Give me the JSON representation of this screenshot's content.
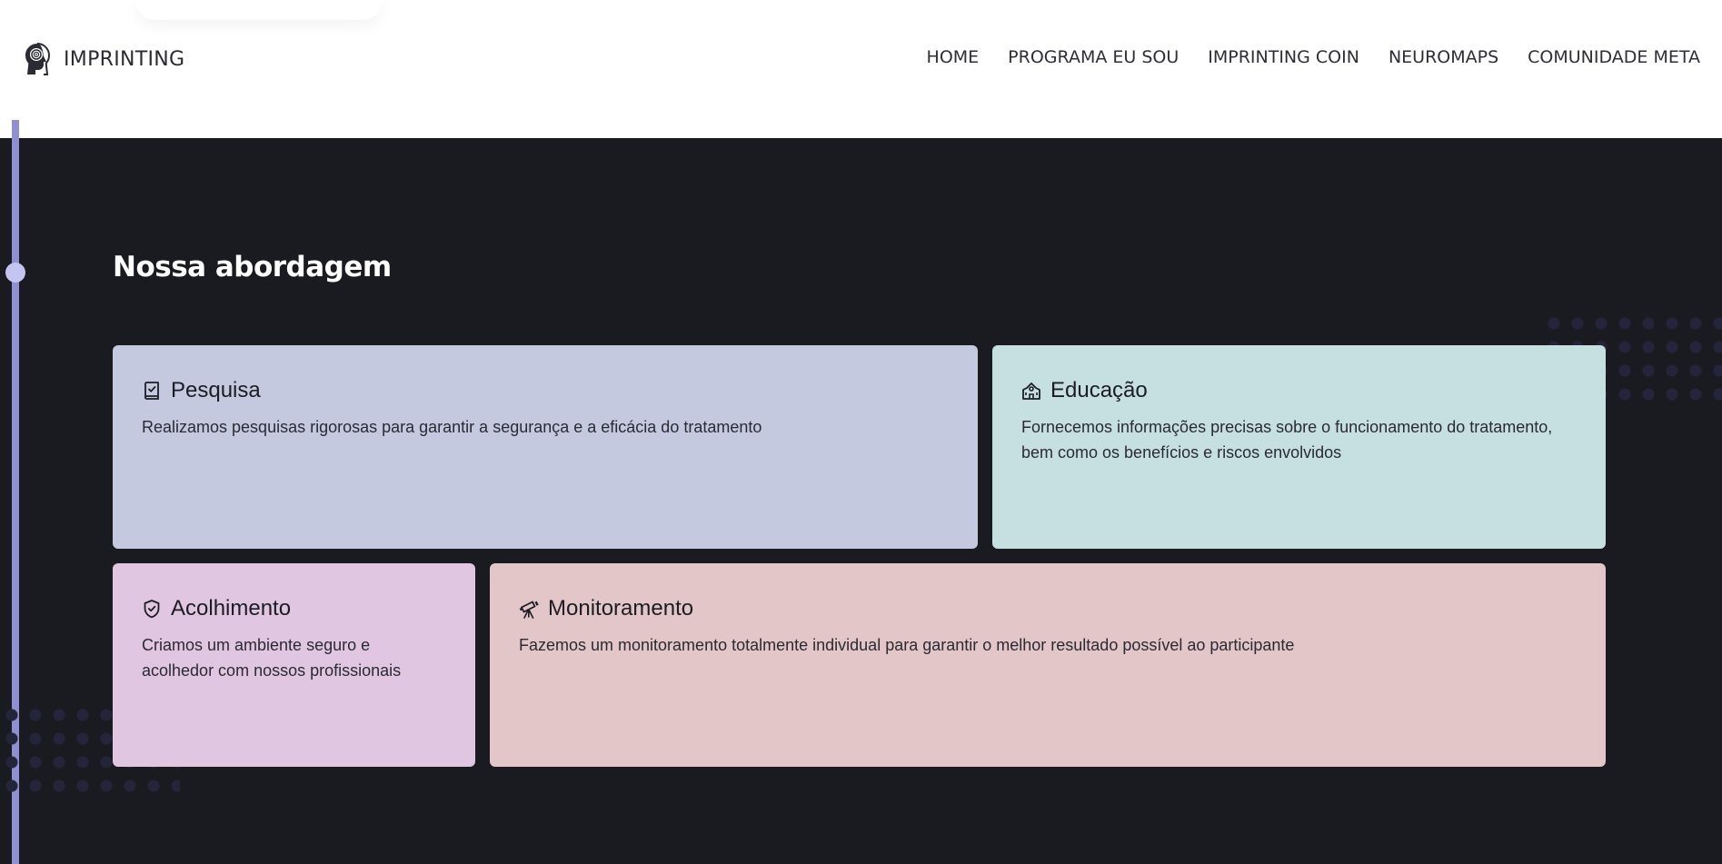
{
  "header": {
    "brand": "IMPRINTING",
    "nav": [
      "HOME",
      "PROGRAMA EU SOU",
      "IMPRINTING COIN",
      "NEUROMAPS",
      "COMUNIDADE META"
    ]
  },
  "section": {
    "title": "Nossa abordagem",
    "cards": [
      {
        "title": "Pesquisa",
        "icon": "book-check-icon",
        "text": "Realizamos pesquisas rigorosas para garantir a segurança e a eficácia do tratamento",
        "color": "#c5c9e0"
      },
      {
        "title": "Educação",
        "icon": "school-icon",
        "text": "Fornecemos informações precisas sobre o funcionamento do tratamento, bem como os benefícios e riscos envolvidos",
        "color": "#c6e0e2"
      },
      {
        "title": "Acolhimento",
        "icon": "shield-check-icon",
        "text": "Criamos um ambiente seguro e acolhedor com nossos profissionais",
        "color": "#e0c6e0"
      },
      {
        "title": "Monitoramento",
        "icon": "telescope-icon",
        "text": "Fazemos um monitoramento totalmente individual para garantir o melhor resultado possível ao participante",
        "color": "#e2c6c8"
      }
    ]
  },
  "colors": {
    "background": "#1a1a21",
    "header": "#ffffff",
    "timeline": "#8f8fd4",
    "timeline_dot": "#c4c4f0"
  }
}
